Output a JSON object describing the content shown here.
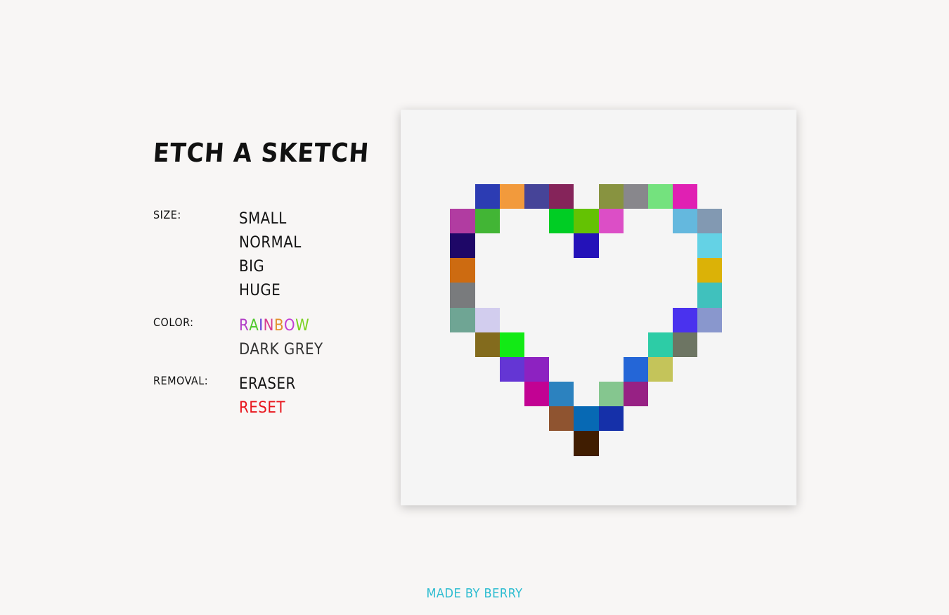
{
  "title": "Etch a Sketch",
  "controls": {
    "size_label": "Size:",
    "size_options": [
      "Small",
      "Normal",
      "Big",
      "Huge"
    ],
    "color_label": "Color:",
    "rainbow_letters": [
      {
        "ch": "R",
        "color": "#b13cc6"
      },
      {
        "ch": "A",
        "color": "#4ec92b"
      },
      {
        "ch": "I",
        "color": "#5b35d9"
      },
      {
        "ch": "N",
        "color": "#d63b8f"
      },
      {
        "ch": "B",
        "color": "#e2902c"
      },
      {
        "ch": "O",
        "color": "#c23ed4"
      },
      {
        "ch": "W",
        "color": "#7ad11f"
      }
    ],
    "dark_grey": "Dark Grey",
    "removal_label": "Removal:",
    "eraser": "Eraser",
    "reset": "Reset"
  },
  "grid": {
    "size": 16,
    "cells": [
      {
        "r": 3,
        "c": 3,
        "color": "#2c3cb3"
      },
      {
        "r": 3,
        "c": 4,
        "color": "#f29a3c"
      },
      {
        "r": 3,
        "c": 5,
        "color": "#464498"
      },
      {
        "r": 3,
        "c": 6,
        "color": "#85245a"
      },
      {
        "r": 3,
        "c": 8,
        "color": "#889340"
      },
      {
        "r": 3,
        "c": 9,
        "color": "#88878c"
      },
      {
        "r": 3,
        "c": 10,
        "color": "#74e27e"
      },
      {
        "r": 3,
        "c": 11,
        "color": "#e020b3"
      },
      {
        "r": 4,
        "c": 2,
        "color": "#b13ca1"
      },
      {
        "r": 4,
        "c": 3,
        "color": "#42b535"
      },
      {
        "r": 4,
        "c": 6,
        "color": "#00cd24"
      },
      {
        "r": 4,
        "c": 7,
        "color": "#64c203"
      },
      {
        "r": 4,
        "c": 8,
        "color": "#dc4ec6"
      },
      {
        "r": 4,
        "c": 11,
        "color": "#64b8de"
      },
      {
        "r": 4,
        "c": 12,
        "color": "#8299b2"
      },
      {
        "r": 5,
        "c": 2,
        "color": "#1e0767"
      },
      {
        "r": 5,
        "c": 7,
        "color": "#2412b9"
      },
      {
        "r": 5,
        "c": 12,
        "color": "#64d2e5"
      },
      {
        "r": 6,
        "c": 2,
        "color": "#cd6b11"
      },
      {
        "r": 6,
        "c": 12,
        "color": "#dbb207"
      },
      {
        "r": 7,
        "c": 2,
        "color": "#797b7d"
      },
      {
        "r": 7,
        "c": 12,
        "color": "#40c1bd"
      },
      {
        "r": 8,
        "c": 2,
        "color": "#6fa594"
      },
      {
        "r": 8,
        "c": 3,
        "color": "#d2cdee"
      },
      {
        "r": 8,
        "c": 11,
        "color": "#4a32ee"
      },
      {
        "r": 8,
        "c": 12,
        "color": "#8997cd"
      },
      {
        "r": 9,
        "c": 3,
        "color": "#836b1d"
      },
      {
        "r": 9,
        "c": 4,
        "color": "#12ea15"
      },
      {
        "r": 9,
        "c": 10,
        "color": "#2dcca6"
      },
      {
        "r": 9,
        "c": 11,
        "color": "#6d7563"
      },
      {
        "r": 10,
        "c": 4,
        "color": "#6436d4"
      },
      {
        "r": 10,
        "c": 5,
        "color": "#8d22c1"
      },
      {
        "r": 10,
        "c": 9,
        "color": "#2466d7"
      },
      {
        "r": 10,
        "c": 10,
        "color": "#c4c45a"
      },
      {
        "r": 11,
        "c": 5,
        "color": "#c20293"
      },
      {
        "r": 11,
        "c": 6,
        "color": "#2c82bf"
      },
      {
        "r": 11,
        "c": 8,
        "color": "#85c68f"
      },
      {
        "r": 11,
        "c": 9,
        "color": "#972184"
      },
      {
        "r": 12,
        "c": 6,
        "color": "#8f5430"
      },
      {
        "r": 12,
        "c": 7,
        "color": "#0769b4"
      },
      {
        "r": 12,
        "c": 8,
        "color": "#1530a9"
      },
      {
        "r": 13,
        "c": 7,
        "color": "#401d01"
      }
    ]
  },
  "footer": "Made by Berry"
}
